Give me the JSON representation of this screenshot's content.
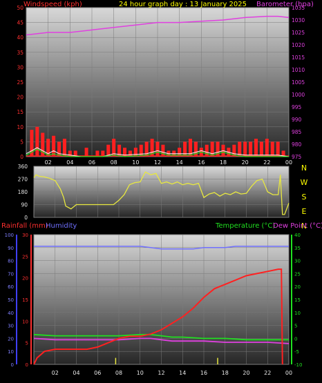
{
  "colors": {
    "wind": "#ff2020",
    "gust": "#ffffff",
    "avg": "#20e020",
    "pressure": "#e040e0",
    "direction": "#e8e840",
    "rain": "#ff2020",
    "humidity": "#7070ff",
    "temperature": "#20e020",
    "dewpoint": "#e040e0",
    "title": "#ffff00"
  },
  "chart_data": [
    {
      "type": "line",
      "title": "24 hour graph day : 13 January 2025",
      "y_left_label": "Windspeed (kph)",
      "y_right_label": "Barometer (hpa)",
      "x_ticks": [
        "02",
        "04",
        "06",
        "08",
        "10",
        "12",
        "14",
        "16",
        "18",
        "20",
        "22",
        "00"
      ],
      "y_left_ticks": [
        0,
        5,
        10,
        15,
        20,
        25,
        30,
        35,
        40,
        45,
        50
      ],
      "y_right_ticks": [
        975,
        980,
        985,
        990,
        995,
        1000,
        1005,
        1010,
        1015,
        1020,
        1025,
        1030,
        1035
      ],
      "ylim_left": [
        0,
        50
      ],
      "ylim_right": [
        975,
        1035
      ],
      "grid": true,
      "series": [
        {
          "key": "wind_peaks",
          "x": [
            0.5,
            1.0,
            1.5,
            2.0,
            2.5,
            3.0,
            3.5,
            4.0,
            4.5,
            5.0,
            5.5,
            6.0,
            6.5,
            7.0,
            7.5,
            8.0,
            8.5,
            9.0,
            9.5,
            10.0,
            10.5,
            11.0,
            11.5,
            12.0,
            12.5,
            13.0,
            13.5,
            14.0,
            14.5,
            15.0,
            15.5,
            16.0,
            16.5,
            17.0,
            17.5,
            18.0,
            18.5,
            19.0,
            19.5,
            20.0,
            20.5,
            21.0,
            21.5,
            22.0,
            22.5,
            23.0,
            23.5
          ],
          "y": [
            9,
            10,
            8,
            6,
            7,
            5,
            6,
            2,
            2,
            0,
            3,
            0,
            2,
            2,
            4,
            6,
            4,
            3,
            2,
            3,
            4,
            5,
            6,
            5,
            4,
            2,
            2,
            3,
            5,
            6,
            5,
            3,
            4,
            5,
            5,
            4,
            3,
            4,
            5,
            5,
            5,
            6,
            5,
            6,
            5,
            5,
            2
          ]
        },
        {
          "key": "gust",
          "x": [
            0,
            0.5,
            1.0,
            1.5,
            2.0,
            2.5,
            3.0,
            4.0,
            5.0,
            7.0,
            8.0,
            9.0,
            11.0,
            12.0,
            13.0,
            15.0,
            16.0,
            17.0,
            18.0,
            19.0,
            20.0,
            22.0,
            23.0,
            24.0
          ],
          "y": [
            1,
            2,
            3,
            2,
            1,
            2,
            1,
            0.5,
            0,
            0,
            1,
            0.5,
            1,
            2,
            1,
            1,
            2,
            1,
            2,
            1,
            0.5,
            0.5,
            0.5,
            0
          ]
        },
        {
          "key": "avg",
          "x": [
            0,
            0.5,
            1.0,
            1.5,
            2.0,
            2.5,
            3.0,
            4.0,
            5.0,
            7.0,
            8.0,
            9.0,
            11.0,
            12.0,
            13.0,
            15.0,
            16.0,
            17.0,
            18.0,
            19.0,
            20.0,
            22.0,
            23.0,
            24.0
          ],
          "y": [
            0.5,
            1.5,
            2.5,
            1.5,
            0.5,
            1,
            0.5,
            0,
            0,
            0,
            0.5,
            0,
            0.5,
            1.5,
            0.5,
            0.5,
            1.5,
            0.5,
            1.5,
            0.5,
            0,
            0,
            0,
            0
          ]
        },
        {
          "key": "pressure",
          "x": [
            0,
            2,
            4,
            6,
            8,
            10,
            12,
            14,
            16,
            18,
            20,
            22,
            23,
            24
          ],
          "y": [
            1024,
            1025,
            1025,
            1026,
            1027,
            1028,
            1029,
            1029,
            1029.5,
            1030,
            1031,
            1031.5,
            1031.5,
            1031
          ]
        }
      ]
    },
    {
      "type": "line",
      "title": "",
      "y_left_ticks": [
        0,
        90,
        180,
        270,
        360
      ],
      "right_labels": [
        "N",
        "W",
        "S",
        "E",
        "N"
      ],
      "ylim": [
        0,
        360
      ],
      "grid": true,
      "series": [
        {
          "key": "direction",
          "x": [
            0,
            0.2,
            0.5,
            1.0,
            1.5,
            2.0,
            2.5,
            2.8,
            3.0,
            3.5,
            4.0,
            5.0,
            6.0,
            7.0,
            7.5,
            8.0,
            8.5,
            9.0,
            9.5,
            10.0,
            10.5,
            11.0,
            11.5,
            12.0,
            12.5,
            13.0,
            13.5,
            14.0,
            14.5,
            15.0,
            15.5,
            16.0,
            16.5,
            17.0,
            17.5,
            18.0,
            18.5,
            19.0,
            19.5,
            20.0,
            20.5,
            21.0,
            21.5,
            22.0,
            22.5,
            23.0,
            23.2,
            23.4,
            23.6,
            24.0
          ],
          "y": [
            280,
            300,
            290,
            285,
            275,
            260,
            200,
            140,
            80,
            60,
            90,
            90,
            90,
            90,
            90,
            120,
            160,
            230,
            245,
            250,
            320,
            300,
            310,
            240,
            250,
            235,
            250,
            230,
            240,
            230,
            240,
            140,
            165,
            175,
            150,
            170,
            160,
            180,
            165,
            170,
            220,
            260,
            270,
            180,
            160,
            160,
            300,
            20,
            20,
            100
          ]
        }
      ]
    },
    {
      "type": "line",
      "title": "",
      "y_left_label": "Rainfall (mm)",
      "y_left2_label": "Humidity",
      "y_right_label": "Temperature (°C)",
      "y_right2_label": "Dew Point (°C)",
      "x_ticks": [
        "02",
        "04",
        "06",
        "08",
        "10",
        "12",
        "14",
        "16",
        "18",
        "20",
        "22",
        "00"
      ],
      "humidity_ticks": [
        0,
        10,
        20,
        30,
        40,
        50,
        60,
        70,
        80,
        90,
        100
      ],
      "rain_ticks": [
        0,
        5,
        10,
        15,
        20,
        25,
        30
      ],
      "temp_ticks": [
        -10,
        -5,
        0,
        5,
        10,
        15,
        20,
        25,
        30,
        35,
        40
      ],
      "ylim_rain": [
        0,
        30
      ],
      "ylim_temp": [
        -10,
        40
      ],
      "grid": true,
      "series": [
        {
          "key": "humidity",
          "axis": "hum",
          "x": [
            0,
            2,
            4,
            6,
            8,
            10,
            11,
            12,
            13,
            14,
            15,
            16,
            17,
            18,
            19,
            20,
            21,
            22,
            23,
            24
          ],
          "y": [
            91,
            91,
            91,
            91,
            91,
            91,
            90,
            89,
            89,
            89,
            89,
            90,
            90,
            90,
            91,
            91,
            91,
            91,
            91,
            91
          ]
        },
        {
          "key": "rain",
          "axis": "rain",
          "x": [
            0,
            0.3,
            1.0,
            2.0,
            3.0,
            4.0,
            5.0,
            6.0,
            7.0,
            8.0,
            9.0,
            10.0,
            11.0,
            12.0,
            13.0,
            14.0,
            15.0,
            16.0,
            17.0,
            18.0,
            19.0,
            20.0,
            21.0,
            22.0,
            23.0,
            23.3,
            23.4
          ],
          "y": [
            0,
            1.5,
            3,
            3.5,
            3.5,
            3.5,
            3.5,
            4,
            5,
            6,
            6.5,
            6.5,
            7,
            8,
            9.5,
            11,
            13,
            15.5,
            17.5,
            18.5,
            19.5,
            20.5,
            21,
            21.5,
            22,
            22,
            0
          ]
        },
        {
          "key": "temperature",
          "axis": "temp",
          "x": [
            0,
            2,
            4,
            6,
            8,
            10,
            11,
            12,
            13,
            14,
            16,
            18,
            20,
            22,
            24
          ],
          "y": [
            1.5,
            1,
            1,
            1,
            1,
            1.5,
            1.5,
            1,
            0.5,
            0.5,
            0,
            0,
            -0.5,
            -0.5,
            -0.5
          ]
        },
        {
          "key": "dewpoint",
          "axis": "temp",
          "x": [
            0,
            2,
            4,
            6,
            8,
            10,
            11,
            12,
            13,
            14,
            16,
            18,
            20,
            22,
            24
          ],
          "y": [
            0,
            -0.5,
            -0.5,
            -0.5,
            -0.5,
            0,
            0,
            -0.5,
            -1,
            -1,
            -1,
            -1.5,
            -1.5,
            -1.5,
            -2
          ]
        }
      ]
    }
  ]
}
